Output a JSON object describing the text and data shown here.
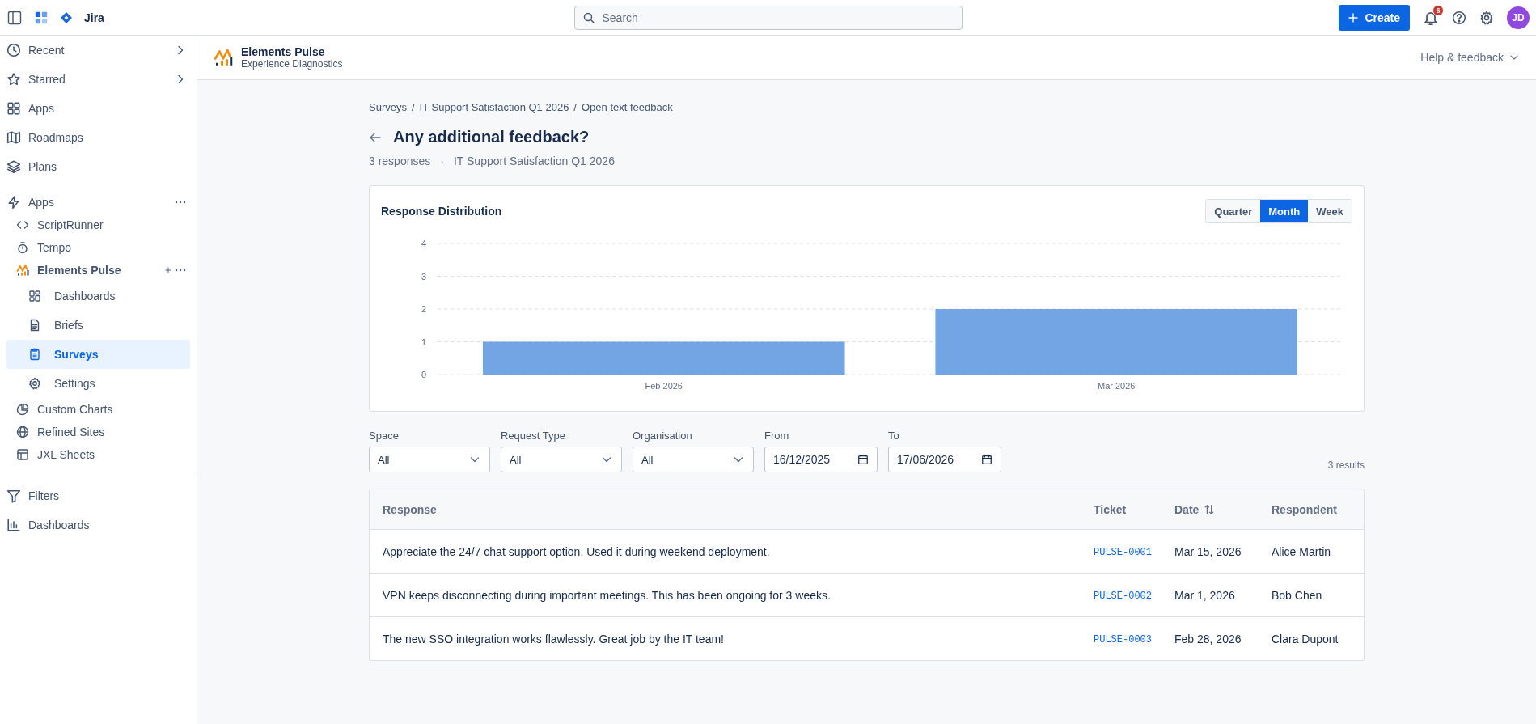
{
  "topbar": {
    "product": "Jira",
    "search": {
      "placeholder": "Search"
    },
    "create_button": "Create",
    "notification_count": "6",
    "avatar": "JD"
  },
  "sidebar": {
    "nav": [
      {
        "label": "Recent",
        "has_submenu": true,
        "selected": false
      },
      {
        "label": "Starred",
        "has_submenu": true,
        "selected": false
      },
      {
        "label": "Apps",
        "has_submenu": false,
        "selected": false
      },
      {
        "label": "Roadmaps",
        "has_submenu": false,
        "selected": false
      },
      {
        "label": "Plans",
        "has_submenu": false,
        "selected": false
      }
    ],
    "apps_section": {
      "title": "Apps",
      "items": [
        {
          "label": "ScriptRunner",
          "selected": false
        },
        {
          "label": "Tempo",
          "selected": false
        },
        {
          "label": "Elements Pulse",
          "selected": false,
          "children": [
            {
              "label": "Dashboards",
              "selected": false
            },
            {
              "label": "Briefs",
              "selected": false
            },
            {
              "label": "Surveys",
              "selected": true
            },
            {
              "label": "Settings",
              "selected": false
            }
          ]
        },
        {
          "label": "Custom Charts",
          "selected": false
        },
        {
          "label": "Refined Sites",
          "selected": false
        },
        {
          "label": "JXL Sheets",
          "selected": false
        }
      ]
    },
    "footer": [
      {
        "label": "Filters",
        "selected": false
      },
      {
        "label": "Dashboards",
        "selected": false
      }
    ]
  },
  "app_header": {
    "name": "Elements Pulse",
    "subtitle": "Experience Diagnostics",
    "help": "Help & feedback"
  },
  "page": {
    "breadcrumbs": [
      "Surveys",
      "IT Support Satisfaction Q1 2026",
      "Open text feedback"
    ],
    "breadcrumb_separator": "/",
    "title": "Any additional feedback?",
    "meta": [
      "3 responses",
      "IT Support Satisfaction Q1 2026"
    ],
    "meta_separator": "·"
  },
  "chart": {
    "title": "Response Distribution",
    "periods": [
      {
        "label": "Quarter",
        "selected": false
      },
      {
        "label": "Month",
        "selected": true
      },
      {
        "label": "Week",
        "selected": false
      }
    ],
    "chart_data": {
      "type": "bar",
      "categories": [
        "Feb 2026",
        "Mar 2026"
      ],
      "series": [
        {
          "color": "#73a4e3",
          "values": [
            1,
            2
          ]
        }
      ],
      "grid": true,
      "ylim": [
        0,
        4
      ],
      "yticks": [
        0,
        1,
        2,
        3,
        4
      ]
    }
  },
  "filters": [
    {
      "label": "Space",
      "kind": "select",
      "value": "All"
    },
    {
      "label": "Request Type",
      "kind": "select",
      "value": "All"
    },
    {
      "label": "Organisation",
      "kind": "select",
      "value": "All"
    },
    {
      "label": "From",
      "kind": "date",
      "value": "16/12/2025"
    },
    {
      "label": "To",
      "kind": "date",
      "value": "17/06/2026"
    }
  ],
  "results_count": "3 results",
  "table": {
    "columns": [
      {
        "label": "Response",
        "sortable": false
      },
      {
        "label": "Ticket",
        "sortable": false
      },
      {
        "label": "Date",
        "sortable": true
      },
      {
        "label": "Respondent",
        "sortable": false
      }
    ],
    "rows": [
      {
        "response": "Appreciate the 24/7 chat support option. Used it during weekend deployment.",
        "ticket": "PULSE-0001",
        "date": "Mar 15, 2026",
        "respondent": "Alice Martin"
      },
      {
        "response": "VPN keeps disconnecting during important meetings. This has been ongoing for 3 weeks.",
        "ticket": "PULSE-0002",
        "date": "Mar 1, 2026",
        "respondent": "Bob Chen"
      },
      {
        "response": "The new SSO integration works flawlessly. Great job by the IT team!",
        "ticket": "PULSE-0003",
        "date": "Feb 28, 2026",
        "respondent": "Clara Dupont"
      }
    ]
  }
}
